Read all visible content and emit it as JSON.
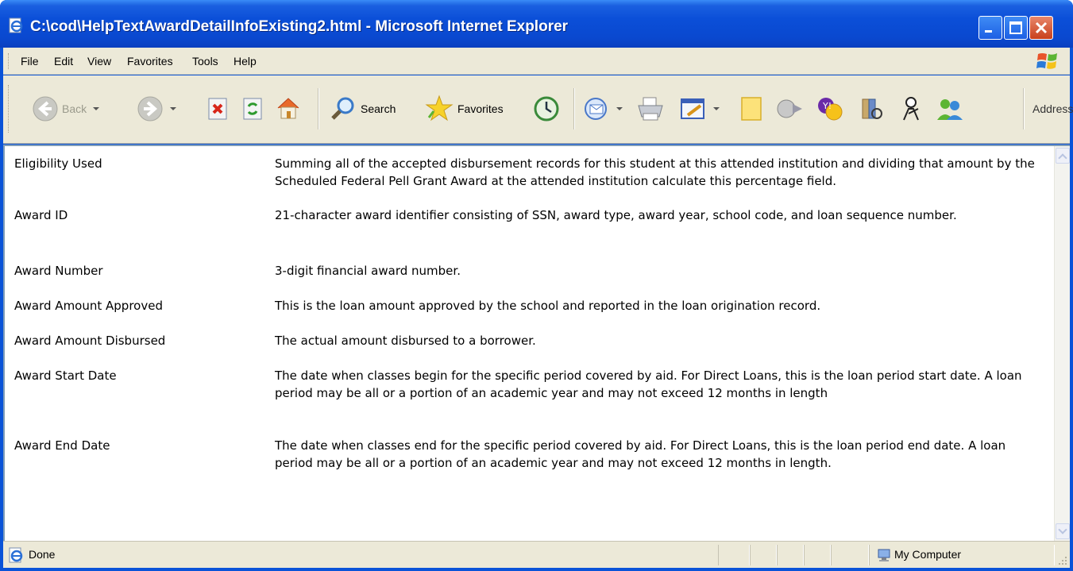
{
  "window": {
    "title": "C:\\cod\\HelpTextAwardDetailInfoExisting2.html - Microsoft Internet Explorer",
    "title_color": "#0a48cf"
  },
  "menu": {
    "items": [
      "File",
      "Edit",
      "View",
      "Favorites",
      "Tools",
      "Help"
    ]
  },
  "toolbar": {
    "back_label": "Back",
    "search_label": "Search",
    "favorites_label": "Favorites",
    "address_label": "Address"
  },
  "content": {
    "rows": [
      {
        "term": "Eligibility Used",
        "description": "Summing all of the accepted disbursement records for this student at this attended institution and dividing that amount by the Scheduled Federal Pell Grant Award at the attended institution calculate this percentage field."
      },
      {
        "term": "Award ID",
        "description": "21-character award identifier consisting of SSN, award type, award year, school code, and loan sequence number."
      },
      {
        "term": "Award Number",
        "description": "3-digit financial award number."
      },
      {
        "term": "Award Amount Approved",
        "description": "This is the loan amount approved by the school and reported in the loan origination record."
      },
      {
        "term": "Award Amount Disbursed",
        "description": "The actual amount disbursed to a borrower."
      },
      {
        "term": "Award Start Date",
        "description": "The date when classes begin for the specific period covered by aid. For Direct Loans, this is the loan period start date. A loan period may be all or a portion of an academic year and may not exceed 12 months in length"
      },
      {
        "term": "Award End Date",
        "description": "The date when classes end for the specific period covered by aid. For Direct Loans, this is the loan period end date. A loan period may be all or a portion of an academic year and may not exceed 12 months in length."
      }
    ]
  },
  "status": {
    "text": "Done",
    "zone": "My Computer"
  },
  "icons": {
    "ie": "ie-page-icon",
    "back": "back-arrow-icon",
    "forward": "forward-arrow-icon",
    "stop": "stop-icon",
    "refresh": "refresh-icon",
    "home": "home-icon",
    "search": "search-magnifier-icon",
    "favorites": "favorites-star-icon",
    "history": "history-icon",
    "mail": "mail-icon",
    "print": "print-icon",
    "edit": "edit-icon",
    "note": "note-icon",
    "media": "media-icon",
    "messenger": "messenger-icon",
    "research": "research-icon",
    "user": "user-icon",
    "contacts": "contacts-icon",
    "computer": "my-computer-icon"
  }
}
